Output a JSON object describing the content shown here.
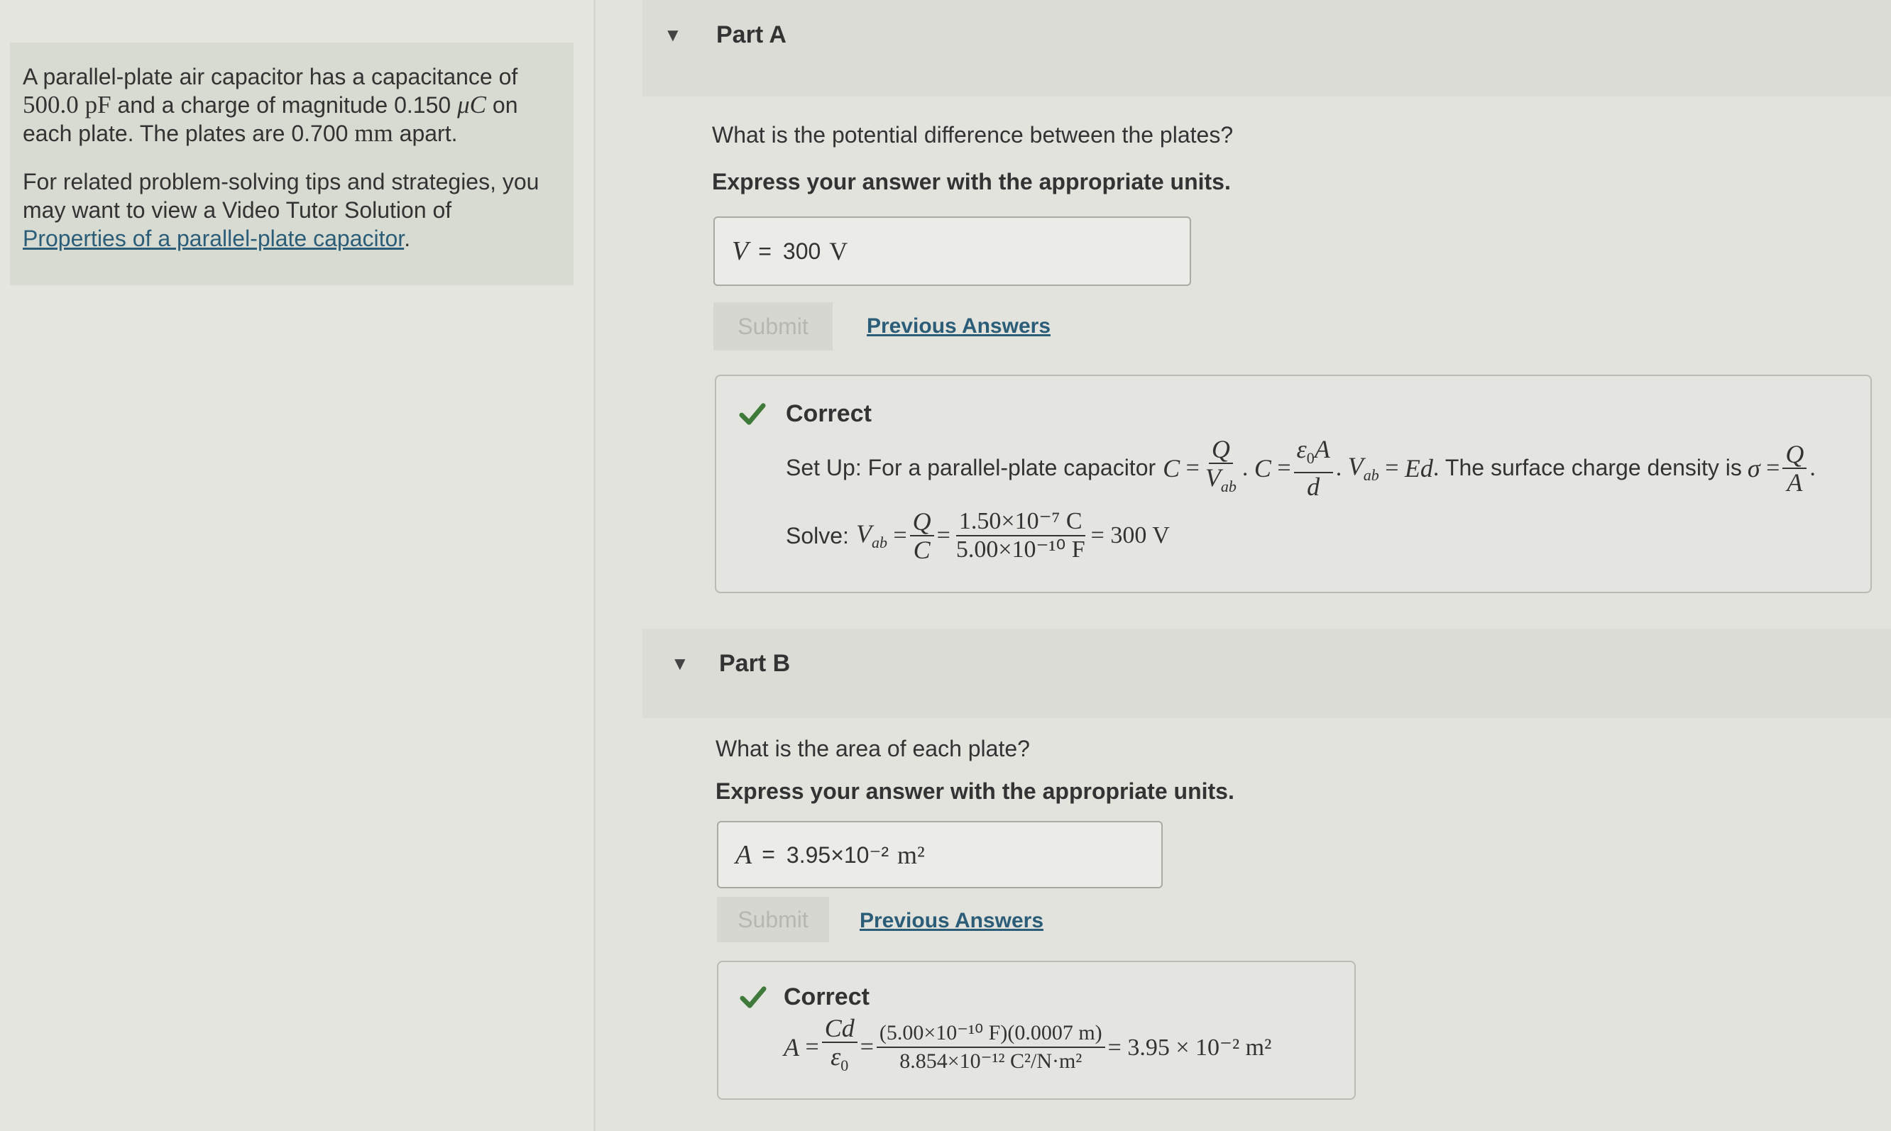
{
  "problem": {
    "text1_pre": "A parallel-plate air capacitor has a capacitance of",
    "cap_value": "500.0",
    "cap_unit": "pF",
    "text1_mid": "and a charge of magnitude 0.150",
    "charge_unit": "μC",
    "text1_on": "on",
    "text1_each": "each plate. The plates are 0.700",
    "dist_unit": "mm",
    "text1_end": "apart.",
    "tips_text": "For related problem-solving tips and strategies, you may want to view a Video Tutor Solution of",
    "tips_link": "Properties of a parallel-plate capacitor",
    "tips_end": "."
  },
  "partA": {
    "title": "Part A",
    "question": "What is the potential difference between the plates?",
    "instruction": "Express your answer with the appropriate units.",
    "answer_var": "V",
    "answer_value": "300",
    "answer_unit": "V",
    "submit_label": "Submit",
    "previous_label": "Previous Answers",
    "feedback_title": "Correct",
    "setup_text": "Set Up: For a parallel-plate capacitor",
    "setup_tail": "The surface charge density is",
    "solve_label": "Solve:",
    "solve_num": "1.50×10⁻⁷ C",
    "solve_den": "5.00×10⁻¹⁰ F",
    "solve_result": "= 300 V"
  },
  "partB": {
    "title": "Part B",
    "question": "What is the area of each plate?",
    "instruction": "Express your answer with the appropriate units.",
    "answer_var": "A",
    "answer_value": "3.95×10⁻²",
    "answer_unit": "m²",
    "submit_label": "Submit",
    "previous_label": "Previous Answers",
    "feedback_title": "Correct",
    "calc_num": "(5.00×10⁻¹⁰ F)(0.0007 m)",
    "calc_den": "8.854×10⁻¹² C²/N·m²",
    "calc_result": "= 3.95 × 10⁻² m²"
  },
  "colors": {
    "check": "#3f7a3a",
    "link": "#2b5d78"
  },
  "icons": {
    "collapse": "triangle-down-icon",
    "check": "checkmark-icon"
  }
}
